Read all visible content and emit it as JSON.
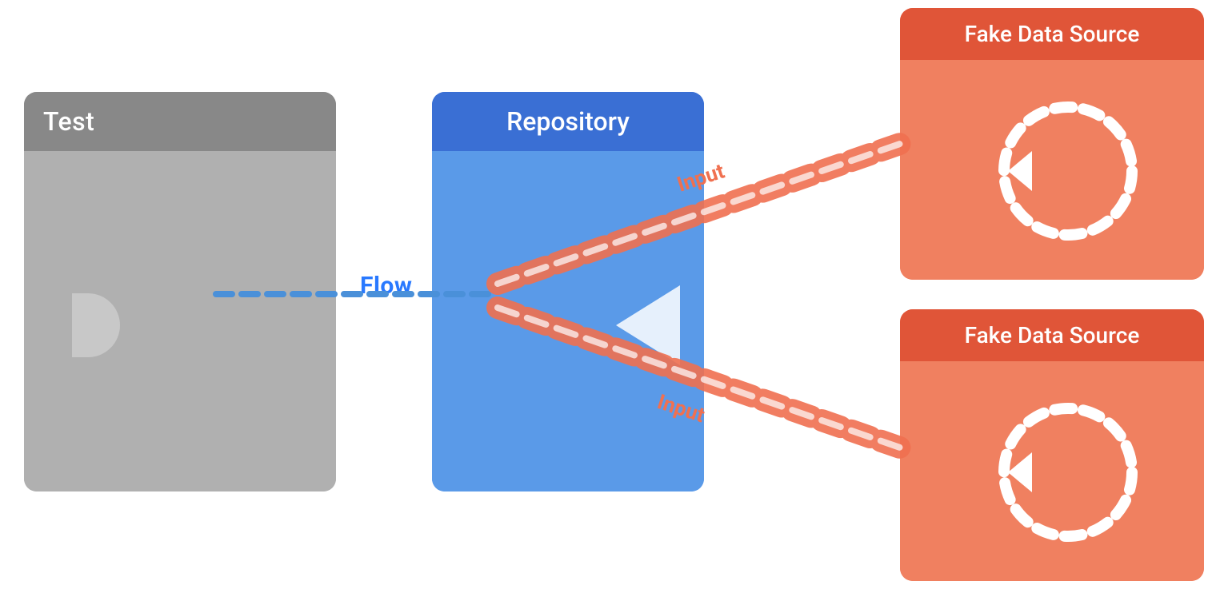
{
  "blocks": {
    "test": {
      "header": "Test",
      "header_bg": "#808080",
      "body_bg": "#aaaaaa"
    },
    "repository": {
      "header": "Repository",
      "header_bg": "#3a6fd4",
      "body_bg": "#5a9ae8"
    },
    "fake_data_source_1": {
      "header": "Fake Data Source",
      "header_bg": "#e05538",
      "body_bg": "#f08060",
      "label": "Input"
    },
    "fake_data_source_2": {
      "header": "Fake Data Source",
      "header_bg": "#e05538",
      "body_bg": "#f08060",
      "label": "Input"
    }
  },
  "flow_label": "Flow",
  "colors": {
    "flow_line": "#4a90d9",
    "input_line": "#f07050",
    "flow_label_color": "#2979FF"
  }
}
